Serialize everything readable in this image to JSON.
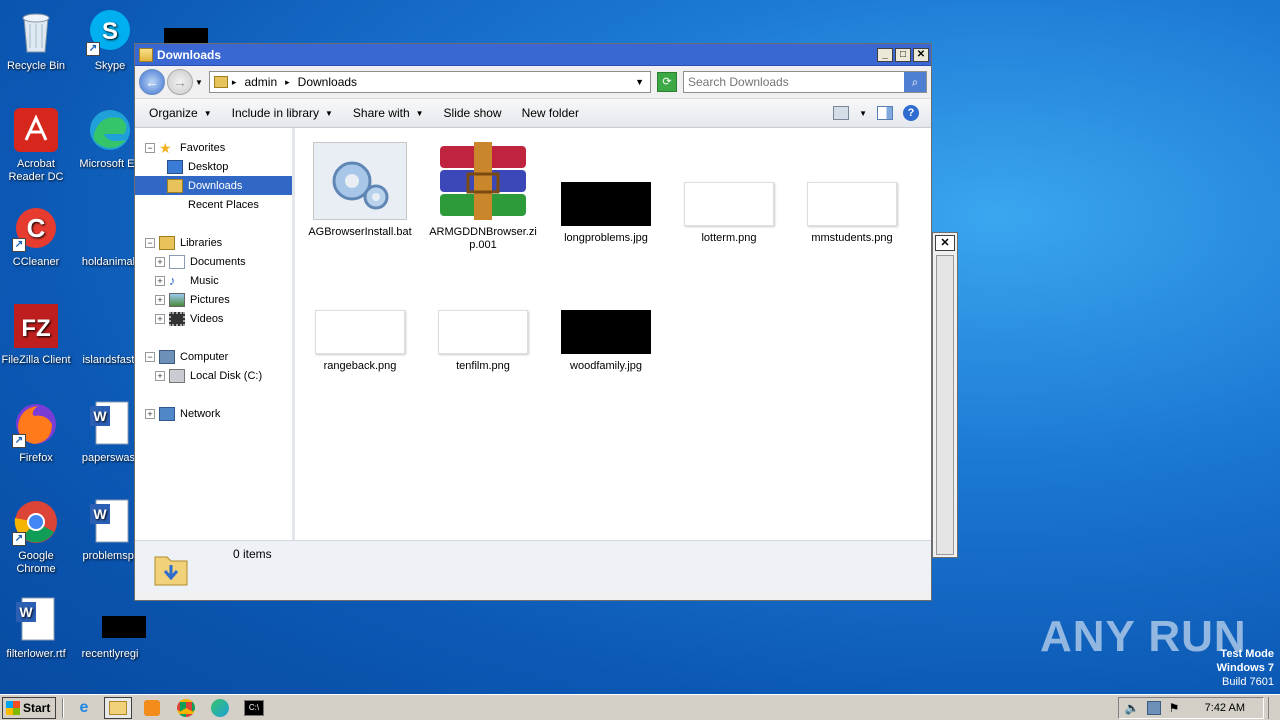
{
  "desktop": {
    "icons": [
      {
        "label": "Recycle Bin",
        "icon": "recycle-bin-icon"
      },
      {
        "label": "Skype",
        "icon": "skype-icon"
      },
      {
        "label": "Acrobat Reader DC",
        "icon": "acrobat-icon"
      },
      {
        "label": "Microsoft Ed",
        "icon": "edge-icon"
      },
      {
        "label": "CCleaner",
        "icon": "ccleaner-icon"
      },
      {
        "label": "holdanimal.",
        "icon": "file-icon"
      },
      {
        "label": "FileZilla Client",
        "icon": "filezilla-icon"
      },
      {
        "label": "islandsfast.",
        "icon": "file-icon"
      },
      {
        "label": "Firefox",
        "icon": "firefox-icon"
      },
      {
        "label": "paperswast",
        "icon": "word-doc-icon"
      },
      {
        "label": "Google Chrome",
        "icon": "chrome-icon"
      },
      {
        "label": "problemspr",
        "icon": "word-doc-icon"
      },
      {
        "label": "filterlower.rtf",
        "icon": "word-doc-icon"
      },
      {
        "label": "recentlyregi",
        "icon": "file-icon"
      }
    ]
  },
  "window": {
    "title": "Downloads",
    "buttons": {
      "minimize": "_",
      "maximize": "□",
      "close": "✕"
    },
    "address": {
      "segments": [
        "admin",
        "Downloads"
      ],
      "separator": "▸"
    },
    "search_placeholder": "Search Downloads",
    "toolbar": {
      "organize": "Organize",
      "include": "Include in library",
      "share": "Share with",
      "slideshow": "Slide show",
      "newfolder": "New folder"
    },
    "nav": {
      "favorites": "Favorites",
      "desktop": "Desktop",
      "downloads": "Downloads",
      "recent": "Recent Places",
      "libraries": "Libraries",
      "documents": "Documents",
      "music": "Music",
      "pictures": "Pictures",
      "videos": "Videos",
      "computer": "Computer",
      "localdisk": "Local Disk (C:)",
      "network": "Network"
    },
    "files": [
      {
        "name": "AGBrowserInstall.bat",
        "type": "bat"
      },
      {
        "name": "ARMGDDNBrowser.zip.001",
        "type": "archive"
      },
      {
        "name": "longproblems.jpg",
        "type": "image-dark"
      },
      {
        "name": "lotterm.png",
        "type": "image-light"
      },
      {
        "name": "mmstudents.png",
        "type": "image-light"
      },
      {
        "name": "rangeback.png",
        "type": "image-light"
      },
      {
        "name": "tenfilm.png",
        "type": "image-light"
      },
      {
        "name": "woodfamily.jpg",
        "type": "image-dark"
      }
    ],
    "status": "0 items"
  },
  "watermark": "ANY RUN",
  "testmode": {
    "line1": "Test Mode",
    "line2": "Windows 7",
    "line3": "Build 7601"
  },
  "taskbar": {
    "start": "Start",
    "clock": "7:42 AM"
  },
  "colors": {
    "titlebar": "#3b67d3",
    "selection": "#3168c5",
    "desktop": "#1c78d2"
  }
}
